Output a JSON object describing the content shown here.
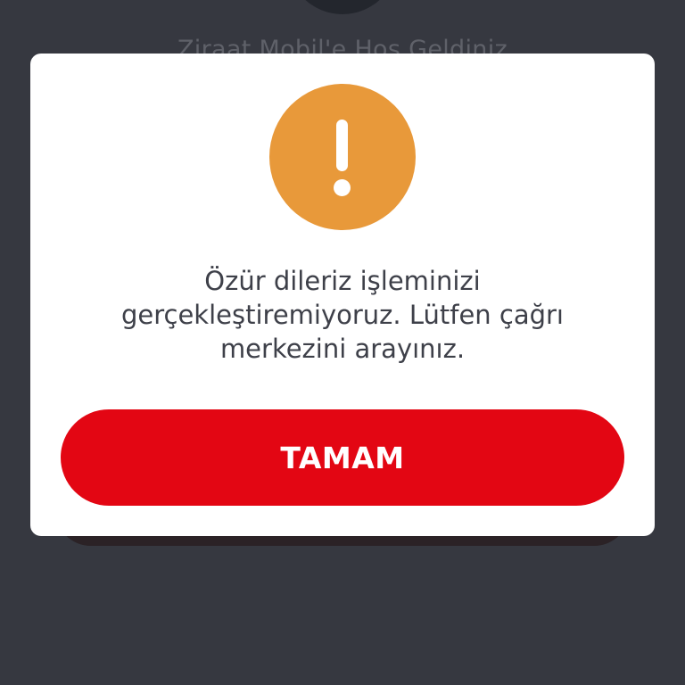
{
  "background": {
    "welcome_text": "Ziraat Mobil'e Hoş Geldiniz"
  },
  "dialog": {
    "icon": "exclamation-alert-icon",
    "icon_color": "#e8993a",
    "message_lines": [
      "Özür dileriz işleminizi",
      "gerçekleştiremiyoruz. Lütfen çağrı",
      "merkezini arayınız."
    ],
    "confirm_label": "TAMAM",
    "confirm_color": "#e30613"
  }
}
